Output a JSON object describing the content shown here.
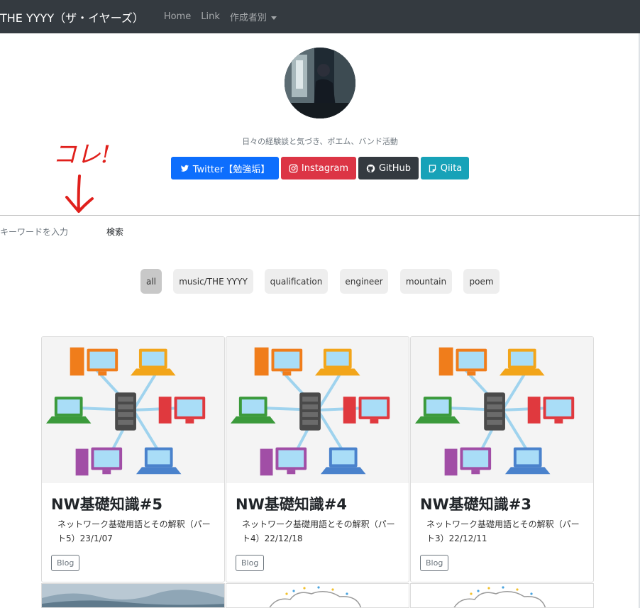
{
  "navbar": {
    "brand": "THE YYYY（ザ・イヤーズ）",
    "links": [
      "Home",
      "Link",
      "作成者別"
    ]
  },
  "profile": {
    "tagline": "日々の経験談と気づき、ポエム、バンド活動",
    "buttons": {
      "twitter": "Twitter【勉強垢】",
      "instagram": "Instagram",
      "github": "GitHub",
      "qiita": "Qiita"
    }
  },
  "annotation": {
    "text": "コレ!"
  },
  "search": {
    "placeholder": "キーワードを入力",
    "button": "検索"
  },
  "filters": {
    "all": "all",
    "music": "music/THE YYYY",
    "qualification": "qualification",
    "engineer": "engineer",
    "mountain": "mountain",
    "poem": "poem"
  },
  "cards": [
    {
      "title": "NW基礎知識#5",
      "desc": "ネットワーク基礎用語とその解釈（パート5）23/1/07",
      "tag": "Blog"
    },
    {
      "title": "NW基礎知識#4",
      "desc": "ネットワーク基礎用語とその解釈（パート4）22/12/18",
      "tag": "Blog"
    },
    {
      "title": "NW基礎知識#3",
      "desc": "ネットワーク基礎用語とその解釈（パート3）22/12/11",
      "tag": "Blog"
    }
  ],
  "colors": {
    "navbar": "#343a40",
    "twitter": "#0d6efd",
    "instagram": "#dc3545",
    "github": "#343a40",
    "qiita": "#17a2b8",
    "annotation": "#e0201c"
  }
}
